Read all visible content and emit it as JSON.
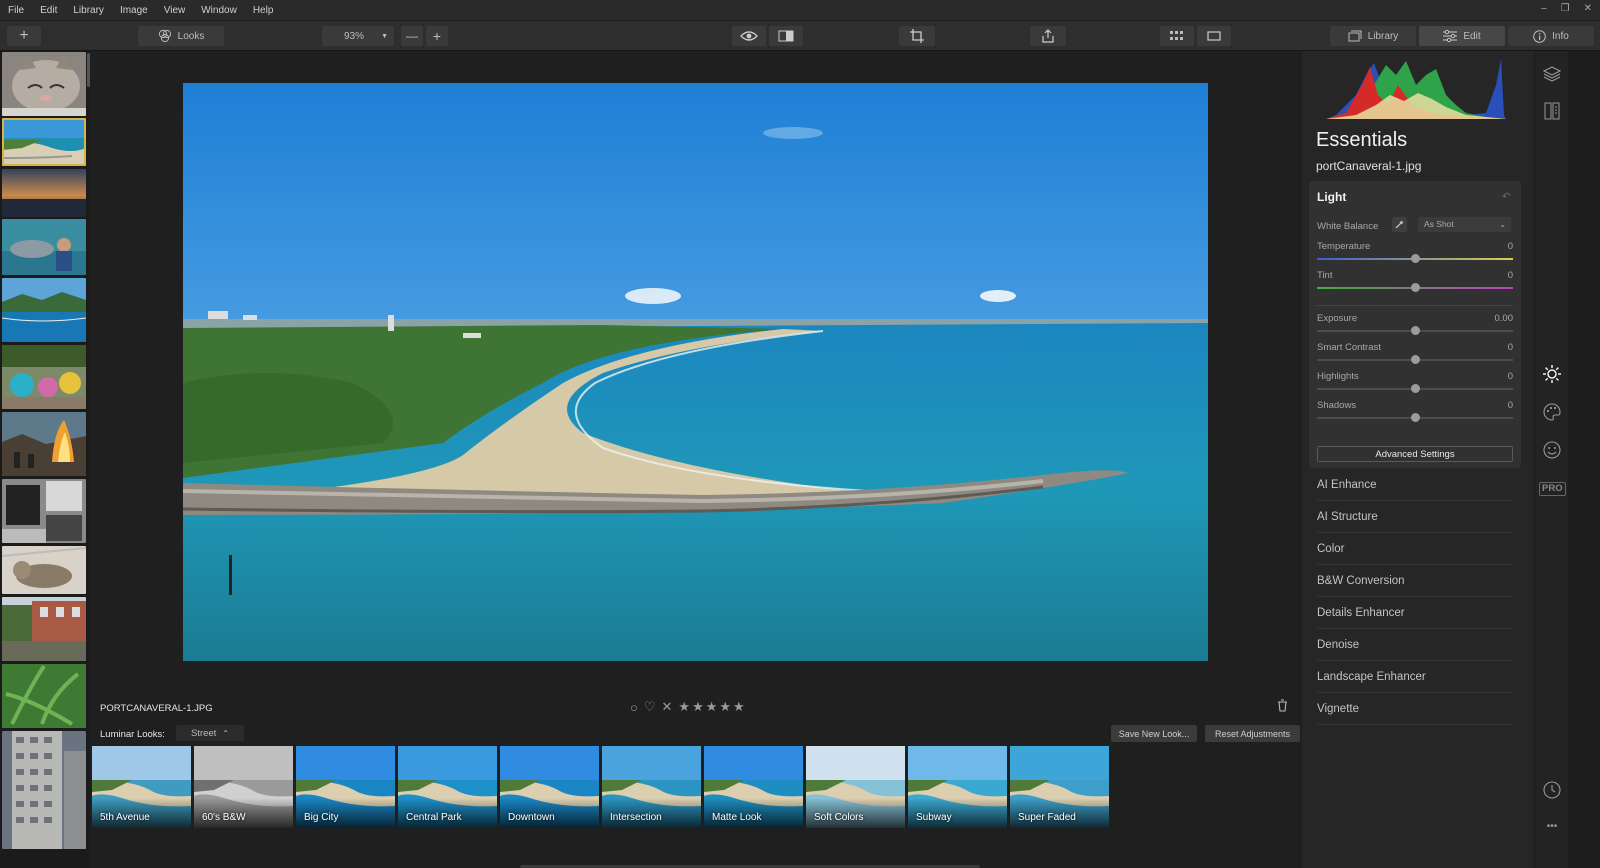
{
  "menu": [
    "File",
    "Edit",
    "Library",
    "Image",
    "View",
    "Window",
    "Help"
  ],
  "window_controls": [
    "–",
    "❐",
    "✕"
  ],
  "toolbar": {
    "add_label": "+",
    "looks_label": "Looks",
    "zoom_value": "93%",
    "zoom_out_label": "—",
    "zoom_in_label": "+",
    "tabs": [
      {
        "label": "Library",
        "active": false
      },
      {
        "label": "Edit",
        "active": true
      },
      {
        "label": "Info",
        "active": false
      }
    ]
  },
  "filmstrip": {
    "selected_index": 1
  },
  "image": {
    "filename_caps": "PORTCANAVERAL-1.JPG",
    "rating_stars": 0
  },
  "looks": {
    "label": "Luminar Looks:",
    "category": "Street",
    "save_label": "Save New Look...",
    "reset_label": "Reset Adjustments",
    "items": [
      "5th Avenue",
      "60's B&W",
      "Big City",
      "Central Park",
      "Downtown",
      "Intersection",
      "Matte Look",
      "Soft Colors",
      "Subway",
      "Super Faded"
    ]
  },
  "panel": {
    "title": "Essentials",
    "filename": "portCanaveral-1.jpg",
    "light": {
      "title": "Light",
      "white_balance_label": "White Balance",
      "white_balance_value": "As Shot",
      "sliders": [
        {
          "label": "Temperature",
          "value": "0",
          "level": 0.5
        },
        {
          "label": "Tint",
          "value": "0",
          "level": 0.5
        },
        {
          "label": "Exposure",
          "value": "0.00",
          "level": 0.5
        },
        {
          "label": "Smart Contrast",
          "value": "0",
          "level": 0.5
        },
        {
          "label": "Highlights",
          "value": "0",
          "level": 0.5
        },
        {
          "label": "Shadows",
          "value": "0",
          "level": 0.5
        }
      ],
      "advanced_label": "Advanced Settings"
    },
    "filters": [
      "AI Enhance",
      "AI Structure",
      "Color",
      "B&W Conversion",
      "Details Enhancer",
      "Denoise",
      "Landscape Enhancer",
      "Vignette"
    ]
  },
  "rail": {
    "pro_label": "PRO",
    "more_label": "•••"
  },
  "colors": {
    "accent_selection": "#d8b348",
    "panel_bg": "#262627",
    "app_bg": "#1d1d1e"
  }
}
